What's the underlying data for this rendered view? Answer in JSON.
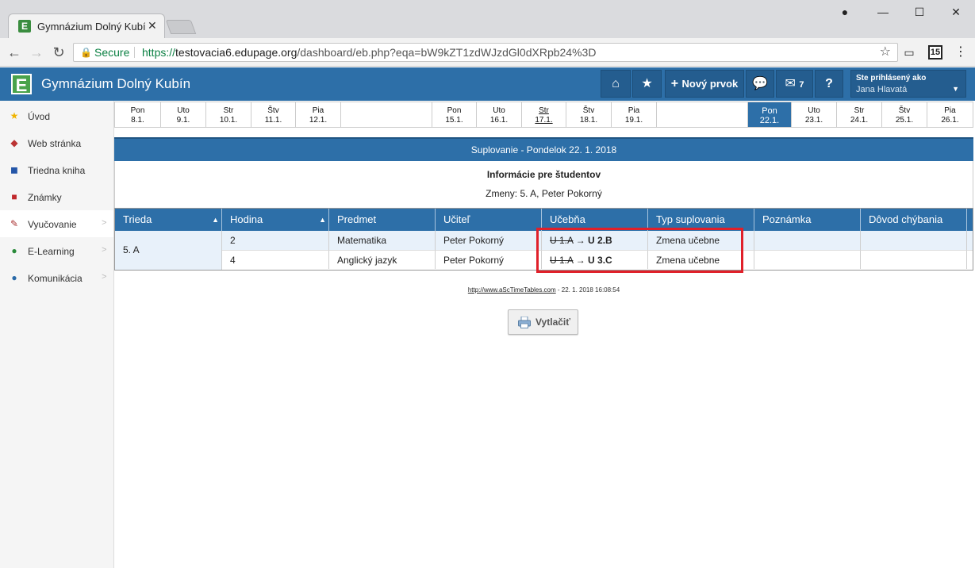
{
  "browser": {
    "tab_title": "Gymnázium Dolný Kubín",
    "tab_favicon": "E",
    "tab_close": "✕",
    "secure_label": "Secure",
    "url_scheme": "https://",
    "url_host": "testovacia6.edupage.org",
    "url_path": "/dashboard/eb.php?eqa=bW9kZT1zdWJzdGl0dXRpb24%3D",
    "calendar_badge": "15"
  },
  "app": {
    "logo": "E",
    "title": "Gymnázium Dolný Kubín",
    "new_item_label": "Nový prvok",
    "messages_count": "7",
    "help_label": "?",
    "user_caption": "Ste prihlásený ako",
    "user_name": "Jana Hlavatá"
  },
  "sidebar": {
    "items": [
      {
        "label": "Úvod",
        "icon": "star-icon"
      },
      {
        "label": "Web stránka",
        "icon": "web-icon"
      },
      {
        "label": "Triedna kniha",
        "icon": "book-icon"
      },
      {
        "label": "Známky",
        "icon": "grades-icon"
      },
      {
        "label": "Vyučovanie",
        "icon": "teaching-icon"
      },
      {
        "label": "E-Learning",
        "icon": "globe-icon"
      },
      {
        "label": "Komunikácia",
        "icon": "communication-icon"
      }
    ]
  },
  "days": [
    {
      "name": "Pon",
      "date": "8.1."
    },
    {
      "name": "Uto",
      "date": "9.1."
    },
    {
      "name": "Str",
      "date": "10.1."
    },
    {
      "name": "Štv",
      "date": "11.1."
    },
    {
      "name": "Pia",
      "date": "12.1."
    },
    {
      "name": "Pon",
      "date": "15.1."
    },
    {
      "name": "Uto",
      "date": "16.1."
    },
    {
      "name": "Str",
      "date": "17.1."
    },
    {
      "name": "Štv",
      "date": "18.1."
    },
    {
      "name": "Pia",
      "date": "19.1."
    },
    {
      "name": "Pon",
      "date": "22.1."
    },
    {
      "name": "Uto",
      "date": "23.1."
    },
    {
      "name": "Str",
      "date": "24.1."
    },
    {
      "name": "Štv",
      "date": "25.1."
    },
    {
      "name": "Pia",
      "date": "26.1."
    }
  ],
  "substitution": {
    "title": "Suplovanie - Pondelok 22. 1. 2018",
    "info_title": "Informácie pre študentov",
    "changes": "Zmeny: 5. A, Peter Pokorný",
    "columns": [
      "Trieda",
      "Hodina",
      "Predmet",
      "Učiteľ",
      "Učebňa",
      "Typ suplovania",
      "Poznámka",
      "Dôvod chýbania"
    ],
    "class_name": "5. A",
    "arrow": "→",
    "rows": [
      {
        "hour": "2",
        "subject": "Matematika",
        "teacher": "Peter Pokorný",
        "room_old": "U 1.A",
        "room_new": "U 2.B",
        "type": "Zmena učebne",
        "note": "",
        "reason": ""
      },
      {
        "hour": "4",
        "subject": "Anglický jazyk",
        "teacher": "Peter Pokorný",
        "room_old": "U 1.A",
        "room_new": "U 3.C",
        "type": "Zmena učebne",
        "note": "",
        "reason": ""
      }
    ]
  },
  "footer": {
    "link": "http://www.aScTimeTables.com",
    "generated": " - 22. 1. 2018 16:08:54"
  },
  "print_label": "Vytlačiť"
}
